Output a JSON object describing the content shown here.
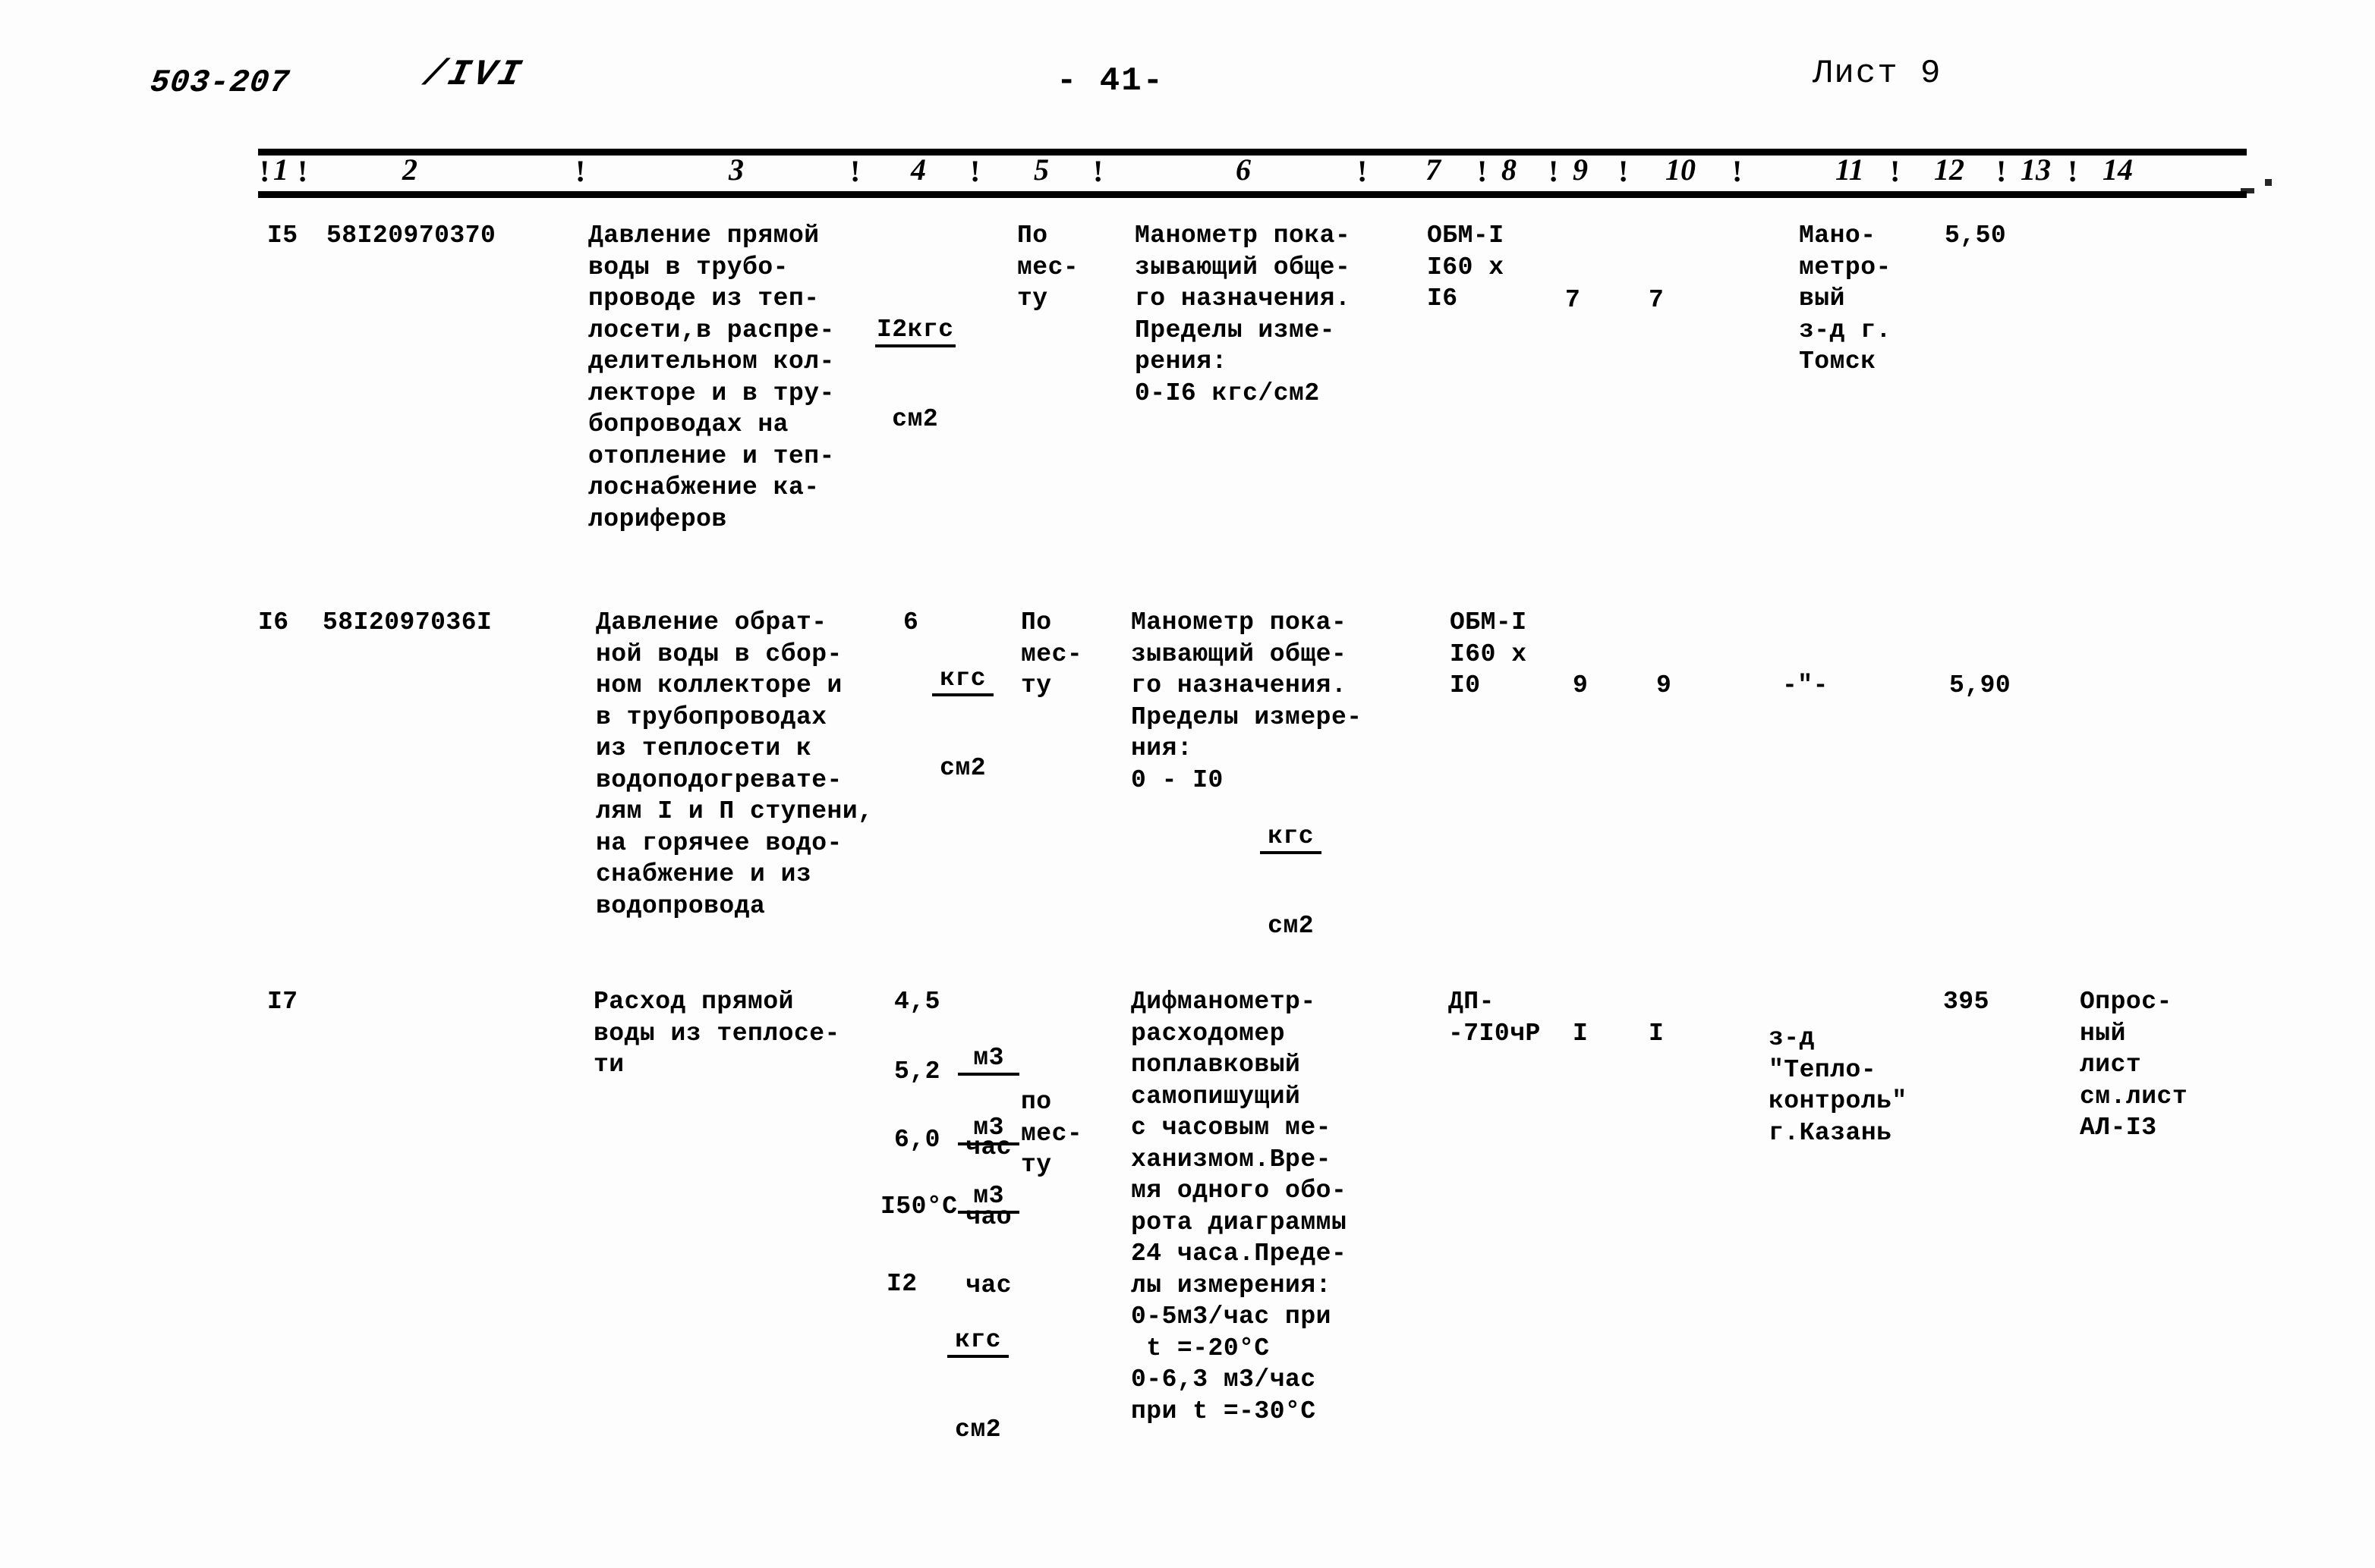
{
  "header": {
    "doc_code": "503-207",
    "revision_mark": "/IVI",
    "page_number": "- 41-",
    "sheet_label": "Лист 9"
  },
  "table": {
    "column_numbers": [
      "1",
      "2",
      "3",
      "4",
      "5",
      "6",
      "7",
      "8",
      "9",
      "10",
      "11",
      "12",
      "13",
      "14"
    ],
    "separator": "!",
    "rows": [
      {
        "pos": "I5",
        "code": "58I20970370",
        "parameter": "Давление прямой\nводы в трубо-\nпроводе из теп-\nлосети,в распре-\nделительном кол-\nлекторе и в тру-\nбопроводах на\nотопление и теп-\nлоснабжение ка-\nлориферов",
        "value_num": "I2кгс",
        "value_den": "см2",
        "place": "По\nмес-\nту",
        "device": "Манометр пока-\nзывающий обще-\nго назначения.\nПределы изме-\nрения:\n0-I6 кгс/см2",
        "type": "ОБМ-I\nI60 x\nI6",
        "qty_a": "7",
        "qty_b": "7",
        "manufacturer": "Мано-\nметро-\nвый\nз-д г.\nТомск",
        "price": "5,50",
        "note": ""
      },
      {
        "pos": "I6",
        "code": "58I2097036I",
        "parameter": "Давление обрат-\nной воды в сбор-\nном коллекторе и\nв трубопроводах\nиз теплосети к\nводоподогревате-\nлям I и П ступени,\nна горячее водо-\nснабжение и из\nводопровода",
        "value_lead": "6",
        "value_num": "кгс",
        "value_den": "см2",
        "place": "По\nмес-\nту",
        "device": "Манометр пока-\nзывающий обще-\nго назначения.\nПределы измере-\nния:",
        "device_range_lead": "0 - I0 ",
        "device_range_num": "кгс",
        "device_range_den": "см2",
        "type": "ОБМ-I\nI60 x\nI0",
        "qty_a": "9",
        "qty_b": "9",
        "manufacturer": "-\"-",
        "price": "5,90",
        "note": ""
      },
      {
        "pos": "I7",
        "code": "",
        "parameter": "Расход прямой\nводы из теплосе-\nти",
        "values": [
          {
            "lead": "4,5 ",
            "num": "м3",
            "den": "час",
            "sup": "3"
          },
          {
            "lead": "5,2 ",
            "num": "м3",
            "den": "чао",
            "sup": ""
          },
          {
            "lead": "6,0 ",
            "num": "м3",
            "den": "час",
            "sup": ""
          }
        ],
        "value_temp": "I50°С",
        "value_press_lead": "I2 ",
        "value_press_num": "кгс",
        "value_press_den": "см2",
        "place": "по\nмес-\nту",
        "device": "Дифманометр-\nрасходомер\nпоплавковый\nсамопишущий\nс часовым ме-\nханизмом.Вре-\nмя одного обо-\nрота диаграммы\n24 часа.Преде-\nлы измерения:\n0-5м3/час при\n t =-20°С\n0-6,3 м3/час\nпри t =-30°С",
        "type": "ДП-\n-7I0чР",
        "qty_a": "I",
        "qty_b": "I",
        "manufacturer": "з-д\n\"Тепло-\nконтроль\"\nг.Казань",
        "price": "395",
        "note": "Опрос-\nный\nлист\nсм.лист\nАЛ-I3"
      }
    ]
  }
}
